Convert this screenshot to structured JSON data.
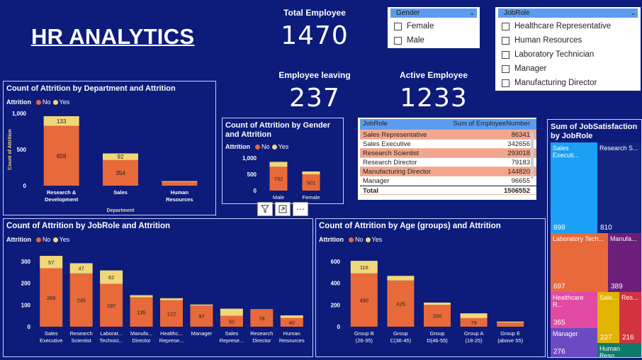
{
  "header": {
    "title": "HR ANALYTICS"
  },
  "kpis": {
    "total": {
      "label": "Total Employee",
      "value": "1470"
    },
    "leaving": {
      "label": "Employee leaving",
      "value": "237"
    },
    "active": {
      "label": "Active Employee",
      "value": "1233"
    }
  },
  "slicers": {
    "gender": {
      "title": "Gender",
      "options": [
        "Female",
        "Male"
      ]
    },
    "jobrole": {
      "title": "JobRole",
      "options": [
        "Healthcare Representative",
        "Human Resources",
        "Laboratory Technician",
        "Manager",
        "Manufacturing Director"
      ]
    }
  },
  "legend": {
    "label": "Attrition",
    "no": "No",
    "yes": "Yes"
  },
  "colors": {
    "no": "#e8693a",
    "yes": "#f0d878",
    "bg": "#0d1b7a"
  },
  "visual_icons": [
    "filter-icon",
    "focus-mode-icon",
    "more-options-icon"
  ],
  "table": {
    "headers": [
      "JobRole",
      "Sum of EmployeeNumber"
    ],
    "rows": [
      [
        "Sales Representative",
        "86341"
      ],
      [
        "Sales Executive",
        "342656"
      ],
      [
        "Research Scientist",
        "293018"
      ],
      [
        "Research Director",
        "79183"
      ],
      [
        "Manufacturing Director",
        "144820"
      ],
      [
        "Manager",
        "96655"
      ]
    ],
    "total": [
      "Total",
      "1506552"
    ]
  },
  "treemap": {
    "title": "Sum of JobSatisfaction by JobRole",
    "tiles": [
      {
        "label": "Sales Executi...",
        "value": "898",
        "color": "#1aa0f5"
      },
      {
        "label": "Research S...",
        "value": "810",
        "color": "#14237f"
      },
      {
        "label": "Laboratory Tech...",
        "value": "697",
        "color": "#e8693a"
      },
      {
        "label": "Manufa...",
        "value": "389",
        "color": "#6b1f7a"
      },
      {
        "label": "Healthcare R...",
        "value": "365",
        "color": "#e24aa4"
      },
      {
        "label": "Sale...",
        "value": "227",
        "color": "#e0b400"
      },
      {
        "label": "Res...",
        "value": "216",
        "color": "#d1333f"
      },
      {
        "label": "Manager",
        "value": "276",
        "color": "#6a4bc4"
      },
      {
        "label": "Human Reso...",
        "value": "",
        "color": "#0f7a6a"
      }
    ]
  },
  "chart_data": [
    {
      "type": "bar",
      "title": "Count of Attrition by Department and Attrition",
      "xlabel": "Department",
      "ylabel": "Count of Attrition",
      "categories": [
        "Research & Development",
        "Sales",
        "Human Resources"
      ],
      "series": [
        {
          "name": "No",
          "values": [
            828,
            354,
            51
          ]
        },
        {
          "name": "Yes",
          "values": [
            133,
            92,
            12
          ]
        }
      ],
      "ylim": [
        0,
        1000
      ],
      "yticks": [
        "0",
        "500",
        "1,000"
      ],
      "labels_no": [
        "828",
        "354",
        ""
      ],
      "labels_yes": [
        "133",
        "92",
        ""
      ]
    },
    {
      "type": "bar",
      "title": "Count of Attrition by Gender and Attrition",
      "categories": [
        "Male",
        "Female"
      ],
      "series": [
        {
          "name": "No",
          "values": [
            732,
            501
          ]
        },
        {
          "name": "Yes",
          "values": [
            150,
            87
          ]
        }
      ],
      "ylim": [
        0,
        1000
      ],
      "yticks": [
        "0",
        "500",
        "1,000"
      ],
      "labels_no": [
        "732",
        "501"
      ],
      "labels_yes": [
        "",
        ""
      ]
    },
    {
      "type": "bar",
      "title": "Count of Attrition by JobRole and Attrition",
      "categories": [
        "Sales Executive",
        "Research Scientist",
        "Laborat... Technici...",
        "Manufa... Director",
        "Healthc... Represe...",
        "Manager",
        "Sales Represe...",
        "Research Director",
        "Human Resources"
      ],
      "series": [
        {
          "name": "No",
          "values": [
            269,
            245,
            197,
            135,
            122,
            97,
            50,
            78,
            40
          ]
        },
        {
          "name": "Yes",
          "values": [
            57,
            47,
            62,
            10,
            9,
            5,
            33,
            2,
            12
          ]
        }
      ],
      "ylim": [
        0,
        300
      ],
      "yticks": [
        "0",
        "100",
        "200",
        "300"
      ],
      "labels_no": [
        "269",
        "245",
        "197",
        "135",
        "122",
        "97",
        "50",
        "78",
        "40"
      ],
      "labels_yes": [
        "57",
        "47",
        "62",
        "",
        "",
        "",
        "",
        "",
        ""
      ]
    },
    {
      "type": "bar",
      "title": "Count of Attrition by Age (groups) and Attrition",
      "categories": [
        "Group B (26-35)",
        "Group C(36-45)",
        "Group D(46-55)",
        "Group A (18-25)",
        "Group E (above 55)"
      ],
      "series": [
        {
          "name": "No",
          "values": [
            490,
            425,
            200,
            79,
            39
          ]
        },
        {
          "name": "Yes",
          "values": [
            116,
            43,
            22,
            44,
            8
          ]
        }
      ],
      "ylim": [
        0,
        600
      ],
      "yticks": [
        "0",
        "200",
        "400",
        "600"
      ],
      "labels_no": [
        "490",
        "425",
        "200",
        "79",
        ""
      ],
      "labels_yes": [
        "116",
        "",
        "",
        "",
        ""
      ]
    }
  ]
}
